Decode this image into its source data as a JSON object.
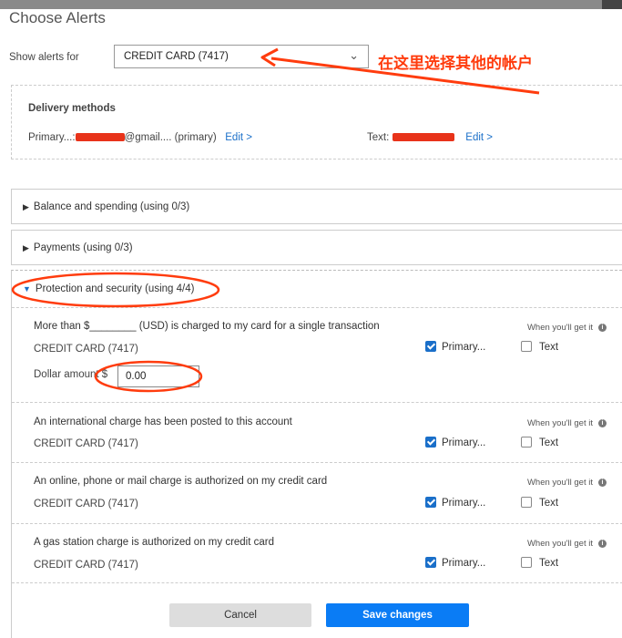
{
  "title": "Choose Alerts",
  "show_alerts": {
    "label": "Show alerts for",
    "selected": "CREDIT CARD (7417)"
  },
  "annotation_text": "在这里选择其他的帐户",
  "delivery": {
    "heading": "Delivery methods",
    "primary_prefix": "Primary...:",
    "primary_suffix": "@gmail.... (primary)",
    "primary_edit": "Edit >",
    "text_prefix": "Text:",
    "text_edit": "Edit >"
  },
  "sections": [
    {
      "label": "Balance and spending (using 0/3)",
      "expanded": false
    },
    {
      "label": "Payments (using 0/3)",
      "expanded": false
    },
    {
      "label": "Protection and security (using 4/4)",
      "expanded": true
    }
  ],
  "alerts": [
    {
      "desc": "More than $________ (USD) is charged to my card for a single transaction",
      "when": "When you'll get it",
      "account": "CREDIT CARD (7417)",
      "primary_label": "Primary...",
      "primary_checked": true,
      "text_label": "Text",
      "text_checked": false,
      "dollar_label": "Dollar amount $",
      "dollar_value": "0.00"
    },
    {
      "desc": "An international charge has been posted to this account",
      "when": "When you'll get it",
      "account": "CREDIT CARD (7417)",
      "primary_label": "Primary...",
      "primary_checked": true,
      "text_label": "Text",
      "text_checked": false
    },
    {
      "desc": "An online, phone or mail charge is authorized on my credit card",
      "when": "When you'll get it",
      "account": "CREDIT CARD (7417)",
      "primary_label": "Primary...",
      "primary_checked": true,
      "text_label": "Text",
      "text_checked": false
    },
    {
      "desc": "A gas station charge is authorized on my credit card",
      "when": "When you'll get it",
      "account": "CREDIT CARD (7417)",
      "primary_label": "Primary...",
      "primary_checked": true,
      "text_label": "Text",
      "text_checked": false
    }
  ],
  "buttons": {
    "cancel": "Cancel",
    "save": "Save changes"
  },
  "colors": {
    "accent": "#1a6fc9",
    "save_button": "#0a7cf5",
    "annotation": "#ff3c0e"
  }
}
